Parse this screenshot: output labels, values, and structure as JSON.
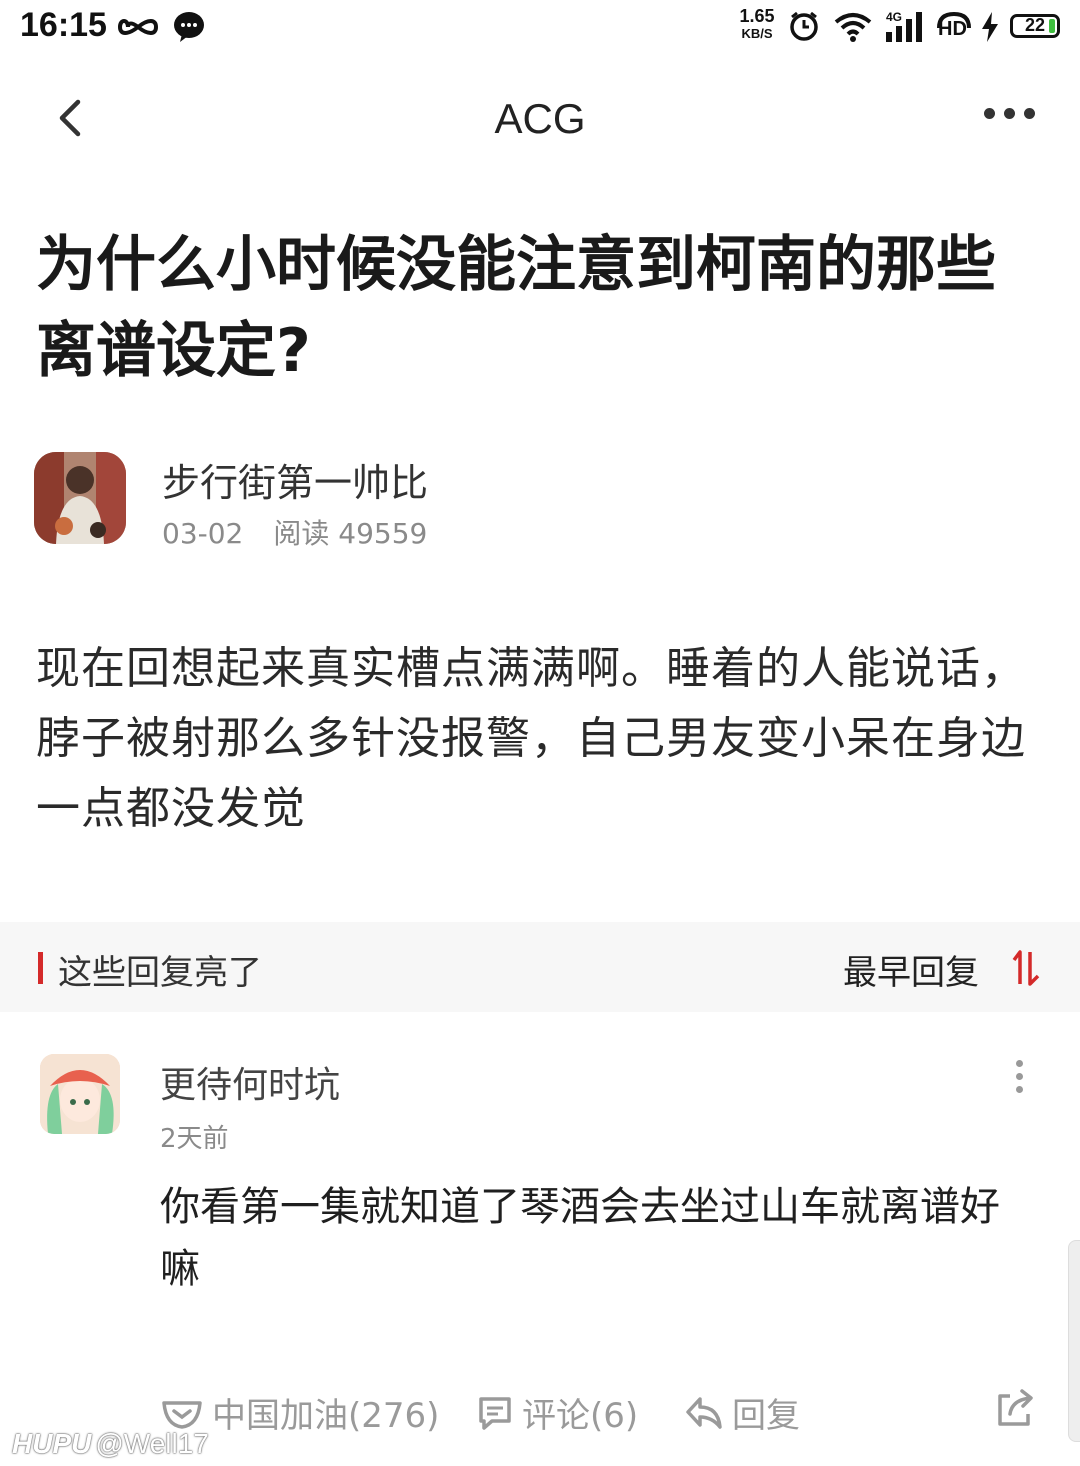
{
  "status_bar": {
    "time": "16:15",
    "net_speed_value": "1.65",
    "net_speed_unit": "KB/S",
    "network_type": "4G",
    "hd_label": "HD",
    "battery": "22"
  },
  "nav": {
    "title": "ACG"
  },
  "post": {
    "title": "为什么小时候没能注意到柯南的那些离谱设定?",
    "author": "步行街第一帅比",
    "date": "03-02",
    "reads": "阅读 49559",
    "body": "现在回想起来真实槽点满满啊。睡着的人能说话，脖子被射那么多针没报警，自己男友变小呆在身边一点都没发觉"
  },
  "replies_section": {
    "title": "这些回复亮了",
    "sort_label": "最早回复"
  },
  "reply": {
    "name": "更待何时坑",
    "time": "2天前",
    "text": "你看第一集就知道了琴酒会去坐过山车就离谱好嘛",
    "light_label": "中国加油(276)",
    "comment_label": "评论(6)",
    "reply_label": "回复"
  },
  "watermark": {
    "brand": "HUPU",
    "handle": "@Well17"
  },
  "colors": {
    "accent": "#d42a2a",
    "section_bg": "#f7f7f7",
    "muted": "#8a8a8a"
  }
}
